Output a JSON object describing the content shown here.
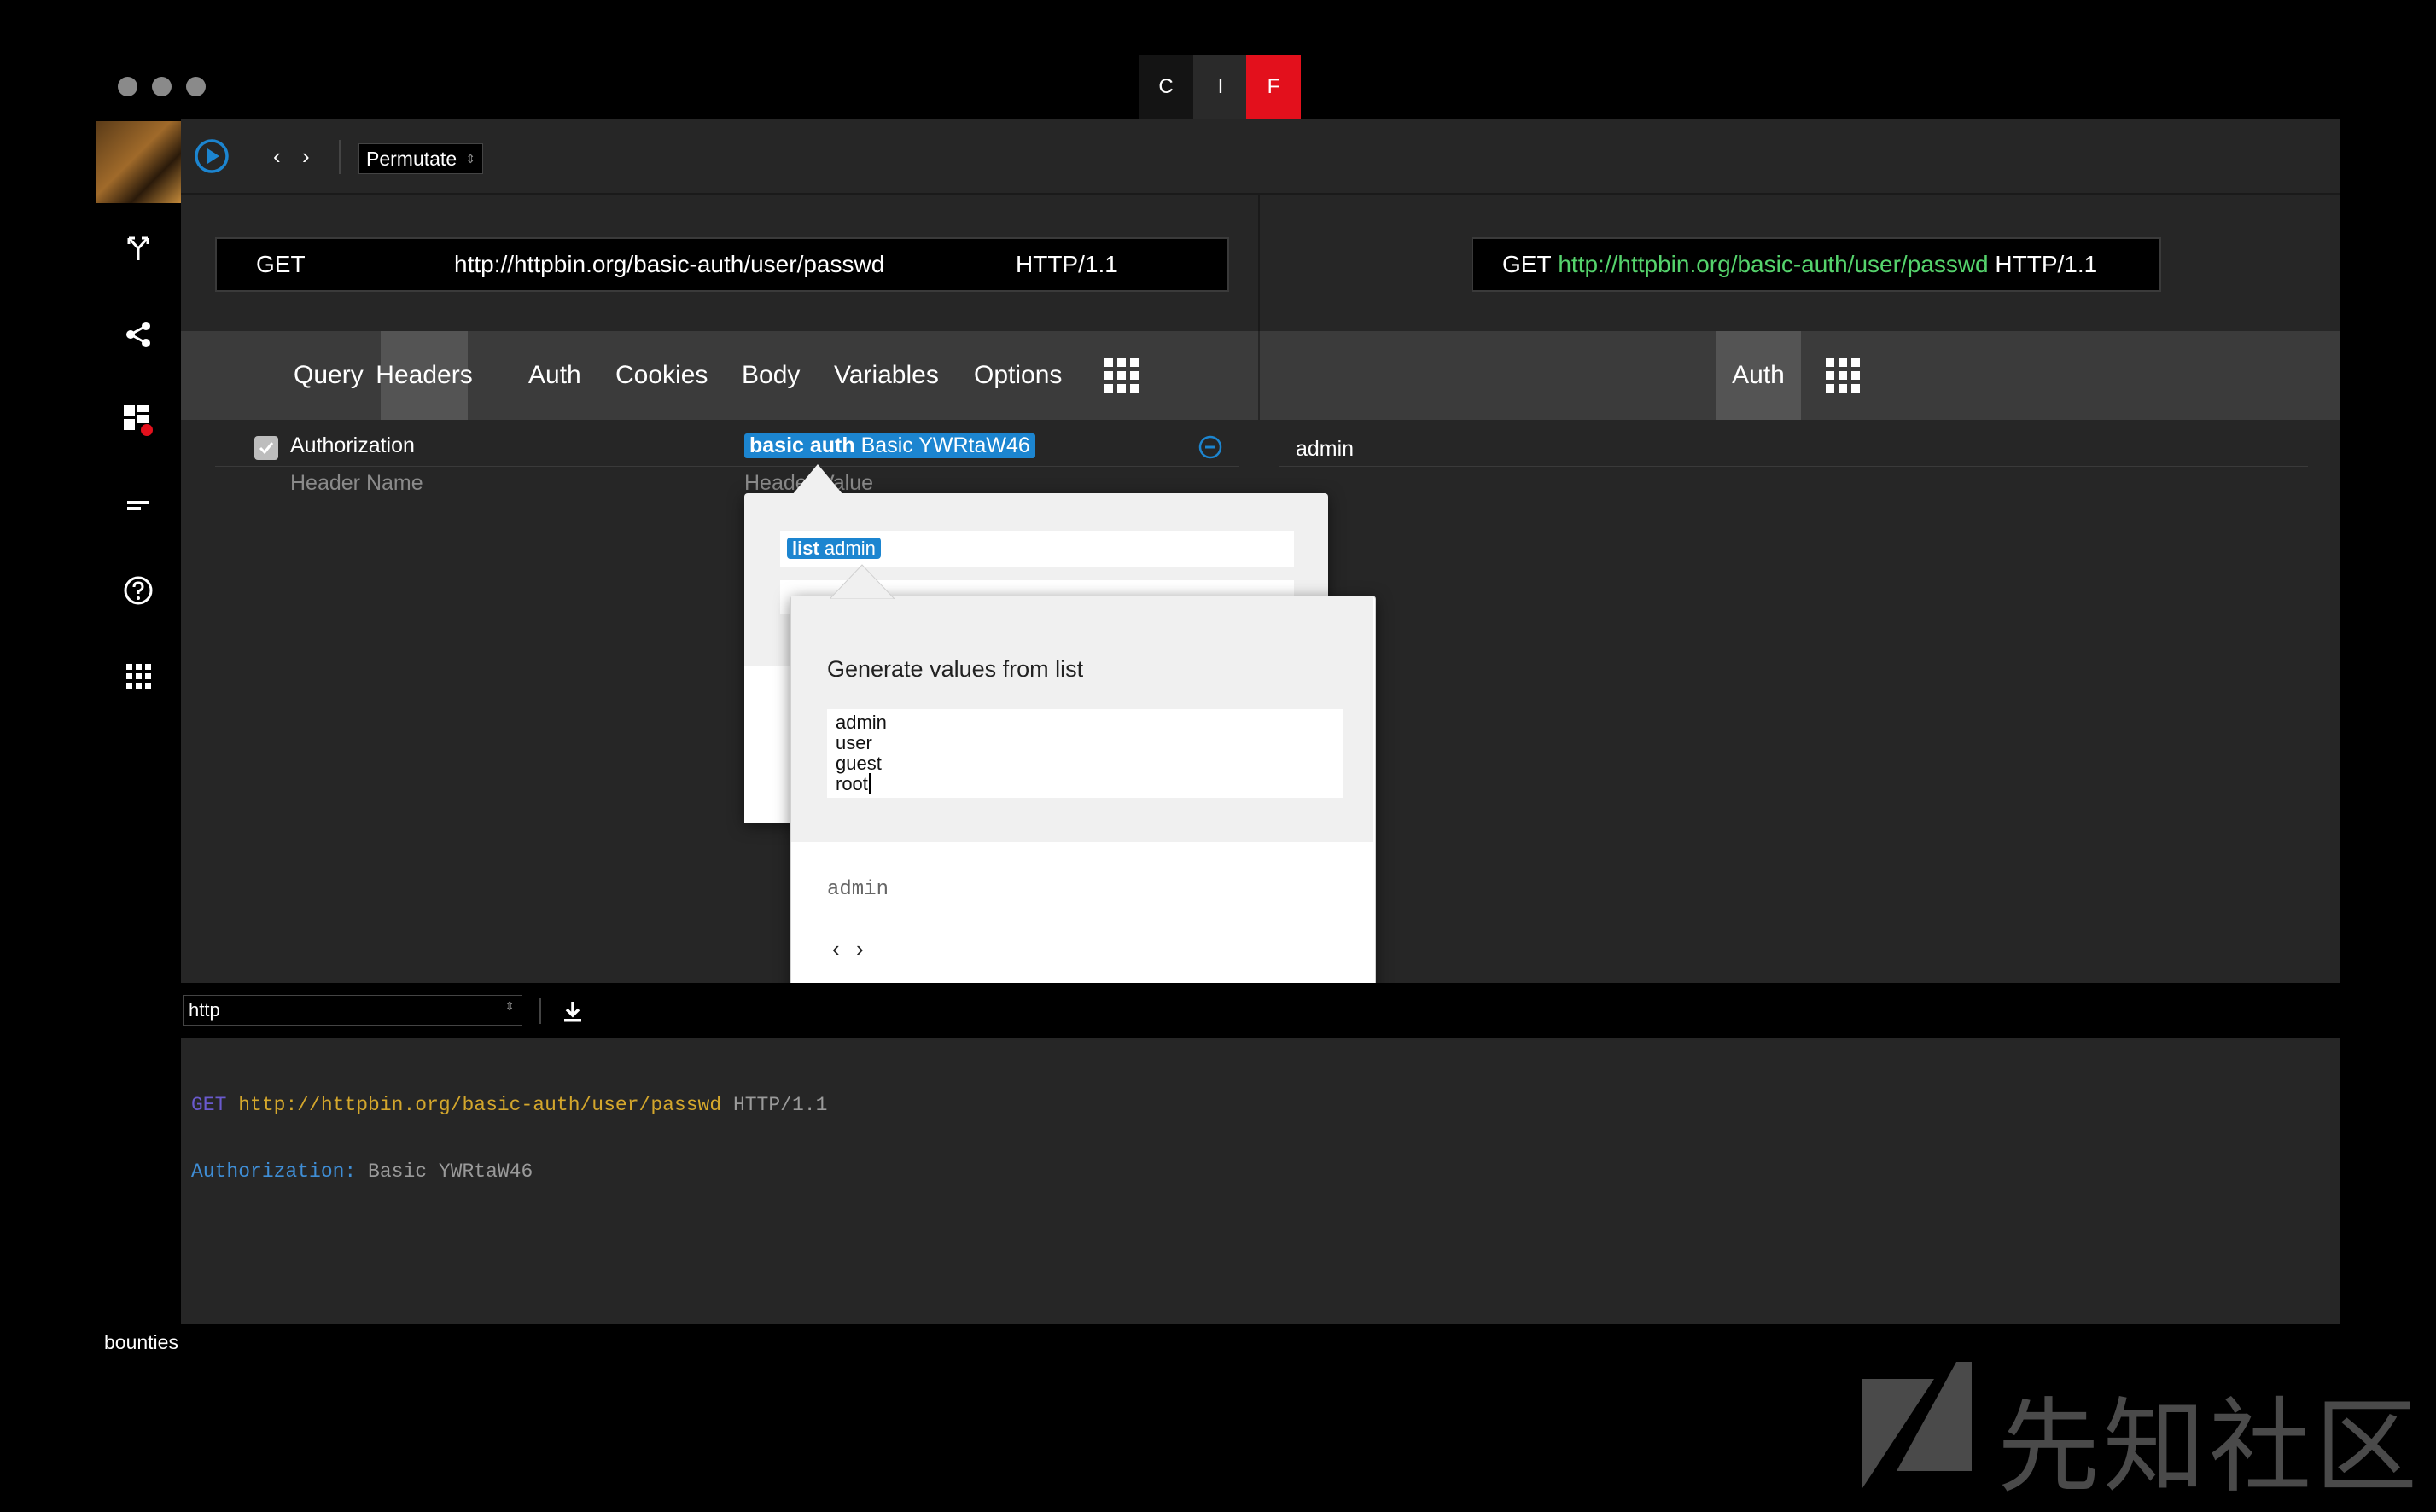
{
  "window_controls": [
    "close",
    "minimize",
    "maximize"
  ],
  "top_tabs": [
    {
      "label": "C",
      "bg": "#141414"
    },
    {
      "label": "I",
      "bg": "#2a2a2a"
    },
    {
      "label": "F",
      "bg": "#e3101c"
    }
  ],
  "sidebar": {
    "icons": [
      "fork-icon",
      "share-icon",
      "dashboard-icon",
      "menu-lines-icon",
      "help-icon",
      "apps-icon"
    ],
    "footer_label": "bounties"
  },
  "toolbar": {
    "mode_select": "Permutate"
  },
  "request": {
    "method": "GET",
    "url": "http://httpbin.org/basic-auth/user/passwd",
    "protocol": "HTTP/1.1"
  },
  "preview_request": {
    "method": "GET",
    "url": "http://httpbin.org/basic-auth/user/passwd",
    "protocol": "HTTP/1.1"
  },
  "left_tabs": [
    "Query",
    "Headers",
    "Auth",
    "Cookies",
    "Body",
    "Variables",
    "Options"
  ],
  "right_tabs": [
    "Auth"
  ],
  "headers": {
    "row_name": "Authorization",
    "row_value_tag": "basic auth",
    "row_value_text": "Basic YWRtaW46",
    "name_placeholder": "Header Name",
    "value_placeholder": "Header Value"
  },
  "right_value": "admin",
  "popup1": {
    "tag": "list",
    "tag_value": "admin"
  },
  "popup2": {
    "title": "Generate values from list",
    "list_values": [
      "admin",
      "user",
      "guest",
      "root"
    ],
    "preview": "admin"
  },
  "bottom_bar": {
    "format_select": "http"
  },
  "log": {
    "method": "GET",
    "url": "http://httpbin.org/basic-auth/user/passwd",
    "protocol": "HTTP/1.1",
    "header_name": "Authorization:",
    "header_value": "Basic YWRtaW46"
  },
  "watermark": "先知社区",
  "colors": {
    "accent_blue": "#1c85d0",
    "url_green": "#55d36c",
    "log_yellow": "#d4a72c",
    "log_purple": "#6a5acd",
    "log_blue": "#3f8ed6"
  }
}
